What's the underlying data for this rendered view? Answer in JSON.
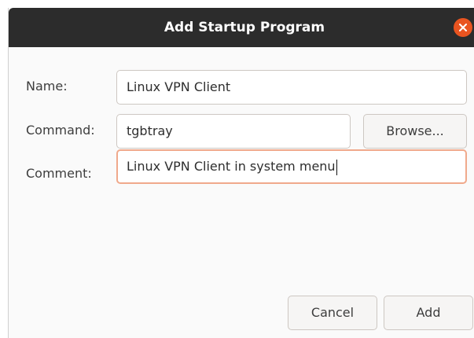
{
  "dialog": {
    "title": "Add Startup Program"
  },
  "form": {
    "name": {
      "label": "Name:",
      "value": "Linux VPN Client"
    },
    "command": {
      "label": "Command:",
      "value": "tgbtray",
      "browse_label": "Browse..."
    },
    "comment": {
      "label": "Comment:",
      "value": "Linux VPN Client in system menu"
    }
  },
  "buttons": {
    "cancel_label": "Cancel",
    "add_label": "Add"
  },
  "icons": {
    "close": "close-icon"
  },
  "colors": {
    "titlebar": "#2c2c2c",
    "close_button": "#e95420",
    "focus_border": "#f0a98b"
  }
}
